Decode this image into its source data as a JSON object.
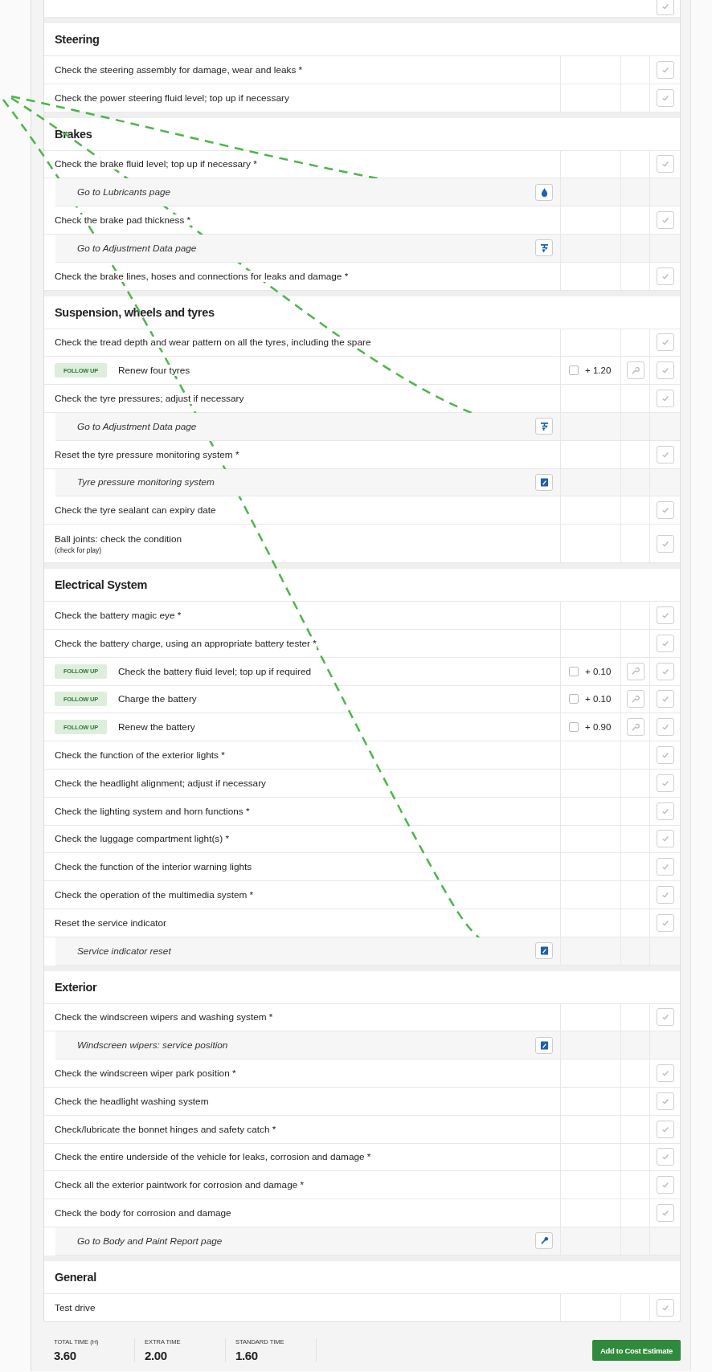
{
  "sections": [
    {
      "title": "Steering",
      "rows": [
        {
          "kind": "check",
          "text": "Check the steering assembly for damage, wear and leaks *"
        },
        {
          "kind": "check",
          "text": "Check the power steering fluid level; top up if necessary"
        }
      ]
    },
    {
      "title": "Brakes",
      "rows": [
        {
          "kind": "check",
          "text": "Check the brake fluid level; top up if necessary *"
        },
        {
          "kind": "link",
          "link": {
            "kind": "lubricants"
          },
          "text": "Go to Lubricants page"
        },
        {
          "kind": "check",
          "text": "Check the brake pad thickness *"
        },
        {
          "kind": "link",
          "link": {
            "kind": "adjustment"
          },
          "text": "Go to Adjustment Data page"
        },
        {
          "kind": "check",
          "text": "Check the brake lines, hoses and connections for leaks and damage *"
        }
      ]
    },
    {
      "title": "Suspension, wheels and tyres",
      "rows": [
        {
          "kind": "check",
          "text": "Check the tread depth and wear pattern on all the tyres, including the spare"
        },
        {
          "kind": "followup",
          "badge": "FOLLOW UP",
          "text": "Renew four tyres",
          "checked": false,
          "extra": "+ 1.20"
        },
        {
          "kind": "check",
          "text": "Check the tyre pressures; adjust if necessary"
        },
        {
          "kind": "link",
          "link": {
            "kind": "adjustment"
          },
          "text": "Go to Adjustment Data page"
        },
        {
          "kind": "check",
          "text": "Reset the tyre pressure monitoring system *"
        },
        {
          "kind": "link",
          "link": {
            "kind": "document"
          },
          "text": "Tyre pressure monitoring system"
        },
        {
          "kind": "check",
          "text": "Check the tyre sealant can expiry date"
        },
        {
          "kind": "check",
          "text": "Ball joints: check the condition",
          "note": "(check for play)"
        }
      ]
    },
    {
      "title": "Electrical System",
      "rows": [
        {
          "kind": "check",
          "text": "Check the battery magic eye *"
        },
        {
          "kind": "check",
          "text": "Check the battery charge, using an appropriate battery tester *"
        },
        {
          "kind": "followup",
          "badge": "FOLLOW UP",
          "text": "Check the battery fluid level; top up if required",
          "checked": false,
          "extra": "+ 0.10"
        },
        {
          "kind": "followup",
          "badge": "FOLLOW UP",
          "text": "Charge the battery",
          "checked": false,
          "extra": "+ 0.10"
        },
        {
          "kind": "followup",
          "badge": "FOLLOW UP",
          "text": "Renew the battery",
          "checked": false,
          "extra": "+ 0.90"
        },
        {
          "kind": "check",
          "text": "Check the function of the exterior lights *"
        },
        {
          "kind": "check",
          "text": "Check the headlight alignment; adjust if necessary"
        },
        {
          "kind": "check",
          "text": "Check the lighting system and horn functions *"
        },
        {
          "kind": "check",
          "text": "Check the luggage compartment light(s) *"
        },
        {
          "kind": "check",
          "text": "Check the function of the interior warning lights"
        },
        {
          "kind": "check",
          "text": "Check the operation of the multimedia system *"
        },
        {
          "kind": "check",
          "text": "Reset the service indicator"
        },
        {
          "kind": "link",
          "link": {
            "kind": "document"
          },
          "text": "Service indicator reset"
        }
      ]
    },
    {
      "title": "Exterior",
      "rows": [
        {
          "kind": "check",
          "text": "Check the windscreen wipers and washing system *"
        },
        {
          "kind": "link",
          "link": {
            "kind": "document"
          },
          "text": "Windscreen wipers: service position"
        },
        {
          "kind": "check",
          "text": "Check the windscreen wiper park position *"
        },
        {
          "kind": "check",
          "text": "Check the headlight washing system"
        },
        {
          "kind": "check",
          "text": "Check/lubricate the bonnet hinges and safety catch *"
        },
        {
          "kind": "check",
          "text": "Check the entire underside of the vehicle for leaks, corrosion and damage *"
        },
        {
          "kind": "check",
          "text": "Check all the exterior paintwork for corrosion and damage *"
        },
        {
          "kind": "check",
          "text": "Check the body for corrosion and damage"
        },
        {
          "kind": "link",
          "link": {
            "kind": "body_paint"
          },
          "text": "Go to Body and Paint Report page"
        }
      ]
    },
    {
      "title": "General",
      "rows": [
        {
          "kind": "check",
          "text": "Test drive"
        }
      ]
    }
  ],
  "footer": {
    "stats": [
      {
        "label": "TOTAL TIME (H)",
        "value": "3.60"
      },
      {
        "label": "EXTRA TIME",
        "value": "2.00"
      },
      {
        "label": "STANDARD TIME",
        "value": "1.60"
      }
    ],
    "button": "Add to Cost Estimate"
  }
}
